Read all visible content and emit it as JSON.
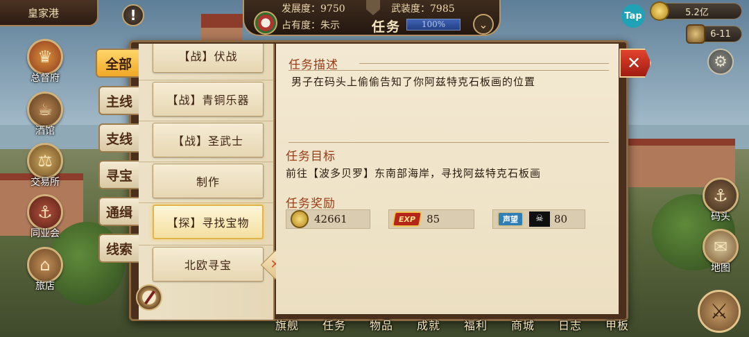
{
  "hud": {
    "port_name": "皇家港",
    "development_label": "发展度：9750",
    "military_label": "武装度：7985",
    "ownership_label": "占有度：朱示",
    "task_label": "任务",
    "task_progress_text": "100%",
    "task_progress_value": 1.0,
    "gold": "5.2亿",
    "date": "6-11",
    "tap_label": "Tap"
  },
  "left_menu": [
    {
      "label": "总督府",
      "icon": "crown-icon",
      "color": "#8f3a1f"
    },
    {
      "label": "酒馆",
      "icon": "barrel-icon",
      "color": "#6a4a2a"
    },
    {
      "label": "交易所",
      "icon": "scales-icon",
      "color": "#7a5a2c"
    },
    {
      "label": "同业会",
      "icon": "anchor-icon",
      "color": "#6a2a1f"
    },
    {
      "label": "旅店",
      "icon": "bed-icon",
      "color": "#7a5634"
    }
  ],
  "right_menu": [
    {
      "label": "码头",
      "icon": "dock-icon"
    },
    {
      "label": "地图",
      "icon": "map-icon"
    }
  ],
  "dialog": {
    "categories": [
      "全部",
      "主线",
      "支线",
      "寻宝",
      "通缉",
      "线索"
    ],
    "active_category": "全部",
    "quests": [
      "【战】伏战",
      "【战】青铜乐器",
      "【战】圣武士",
      "制作",
      "【探】寻找宝物",
      "北欧寻宝"
    ],
    "selected_quest": "【探】寻找宝物",
    "description_title": "任务描述",
    "description_text": "男子在码头上偷偷告知了你阿兹特克石板画的位置",
    "objective_title": "任务目标",
    "objective_text": "前往【波多贝罗】东南部海岸，寻找阿兹特克石板画",
    "reward_title": "任务奖励",
    "rewards": {
      "gold": "42661",
      "exp_badge": "EXP",
      "exp": "85",
      "reputation_badge": "声望",
      "reputation_icon": "pirate-flag-icon",
      "reputation": "80"
    },
    "close_icon": "close-icon",
    "remove_icon": "remove-icon"
  },
  "bottom_nav": [
    "旗舰",
    "任务",
    "物品",
    "成就",
    "福利",
    "商城",
    "日志",
    "甲板"
  ]
}
